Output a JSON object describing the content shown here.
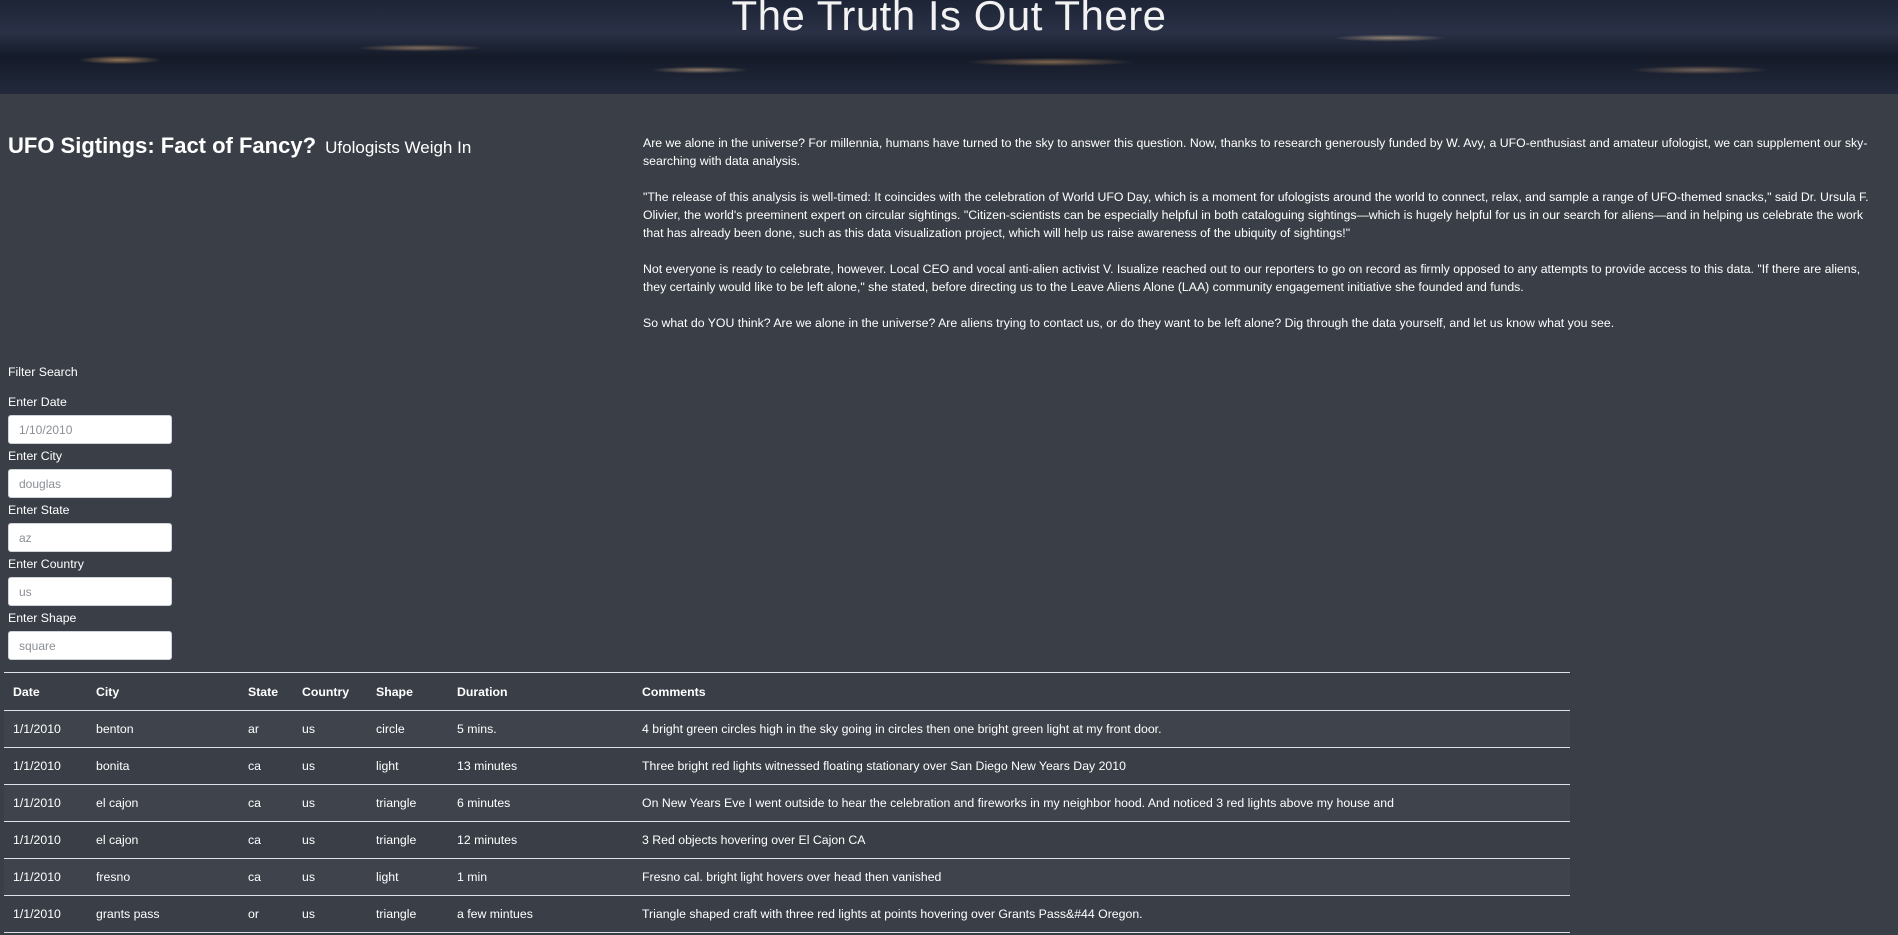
{
  "hero": {
    "title": "The Truth Is Out There"
  },
  "heading": {
    "main": "UFO Sigtings: Fact of Fancy?",
    "sub": "Ufologists Weigh In"
  },
  "article": {
    "paragraphs": [
      "Are we alone in the universe? For millennia, humans have turned to the sky to answer this question. Now, thanks to research generously funded by W. Avy, a UFO-enthusiast and amateur ufologist, we can supplement our sky-searching with data analysis.",
      "\"The release of this analysis is well-timed: It coincides with the celebration of World UFO Day, which is a moment for ufologists around the world to connect, relax, and sample a range of UFO-themed snacks,\" said Dr. Ursula F. Olivier, the world's preeminent expert on circular sightings. \"Citizen-scientists can be especially helpful in both cataloguing sightings—which is hugely helpful for us in our search for aliens—and in helping us celebrate the work that has already been done, such as this data visualization project, which will help us raise awareness of the ubiquity of sightings!\"",
      "Not everyone is ready to celebrate, however. Local CEO and vocal anti-alien activist V. Isualize reached out to our reporters to go on record as firmly opposed to any attempts to provide access to this data. \"If there are aliens, they certainly would like to be left alone,\" she stated, before directing us to the Leave Aliens Alone (LAA) community engagement initiative she founded and funds.",
      "So what do YOU think? Are we alone in the universe? Are aliens trying to contact us, or do they want to be left alone? Dig through the data yourself, and let us know what you see."
    ]
  },
  "filters": {
    "title": "Filter Search",
    "date": {
      "label": "Enter Date",
      "placeholder": "1/10/2010"
    },
    "city": {
      "label": "Enter City",
      "placeholder": "douglas"
    },
    "state": {
      "label": "Enter State",
      "placeholder": "az"
    },
    "country": {
      "label": "Enter Country",
      "placeholder": "us"
    },
    "shape": {
      "label": "Enter Shape",
      "placeholder": "square"
    }
  },
  "table": {
    "headers": [
      "Date",
      "City",
      "State",
      "Country",
      "Shape",
      "Duration",
      "Comments"
    ],
    "rows": [
      [
        "1/1/2010",
        "benton",
        "ar",
        "us",
        "circle",
        "5 mins.",
        "4 bright green circles high in the sky going in circles then one bright green light at my front door."
      ],
      [
        "1/1/2010",
        "bonita",
        "ca",
        "us",
        "light",
        "13 minutes",
        "Three bright red lights witnessed floating stationary over San Diego New Years Day 2010"
      ],
      [
        "1/1/2010",
        "el cajon",
        "ca",
        "us",
        "triangle",
        "6 minutes",
        "On New Years Eve I went outside to hear the celebration and fireworks in my neighbor hood. And noticed 3 red lights above my house and"
      ],
      [
        "1/1/2010",
        "el cajon",
        "ca",
        "us",
        "triangle",
        "12 minutes",
        "3 Red objects hovering over El Cajon CA"
      ],
      [
        "1/1/2010",
        "fresno",
        "ca",
        "us",
        "light",
        "1 min",
        "Fresno cal. bright light hovers over head then vanished"
      ],
      [
        "1/1/2010",
        "grants pass",
        "or",
        "us",
        "triangle",
        "a few mintues",
        "Triangle shaped craft with three red lights at points hovering over Grants Pass&#44 Oregon."
      ]
    ]
  }
}
